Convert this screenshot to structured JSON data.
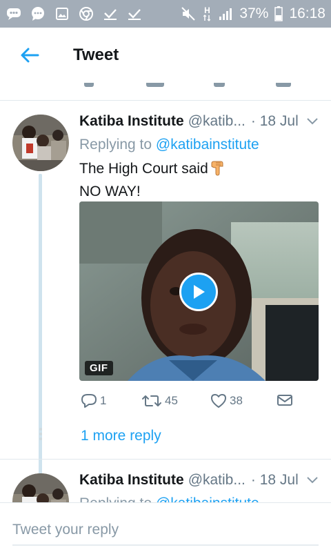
{
  "status_bar": {
    "battery": "37%",
    "time": "16:18",
    "signal_label": "H"
  },
  "app_bar": {
    "title": "Tweet"
  },
  "tweet": {
    "author_name": "Katiba Institute",
    "handle": "@katib...",
    "date": "· 18 Jul",
    "reply_prefix": "Replying to",
    "reply_to": "@katibainstitute",
    "text_line1": "The High Court said",
    "text_line2": "NO WAY!",
    "emoji": "pointing-down-hand",
    "media_badge": "GIF",
    "replies_count": "1",
    "retweets_count": "45",
    "likes_count": "38",
    "more_replies": "1 more reply"
  },
  "next_tweet": {
    "author_name": "Katiba Institute",
    "handle": "@katib...",
    "date": "· 18 Jul",
    "reply_prefix": "Replying to",
    "reply_to": "@katibainstitute"
  },
  "composer": {
    "placeholder": "Tweet your reply"
  },
  "colors": {
    "accent": "#1da1f2",
    "statusbar": "#a3adb8",
    "muted": "#657786"
  }
}
